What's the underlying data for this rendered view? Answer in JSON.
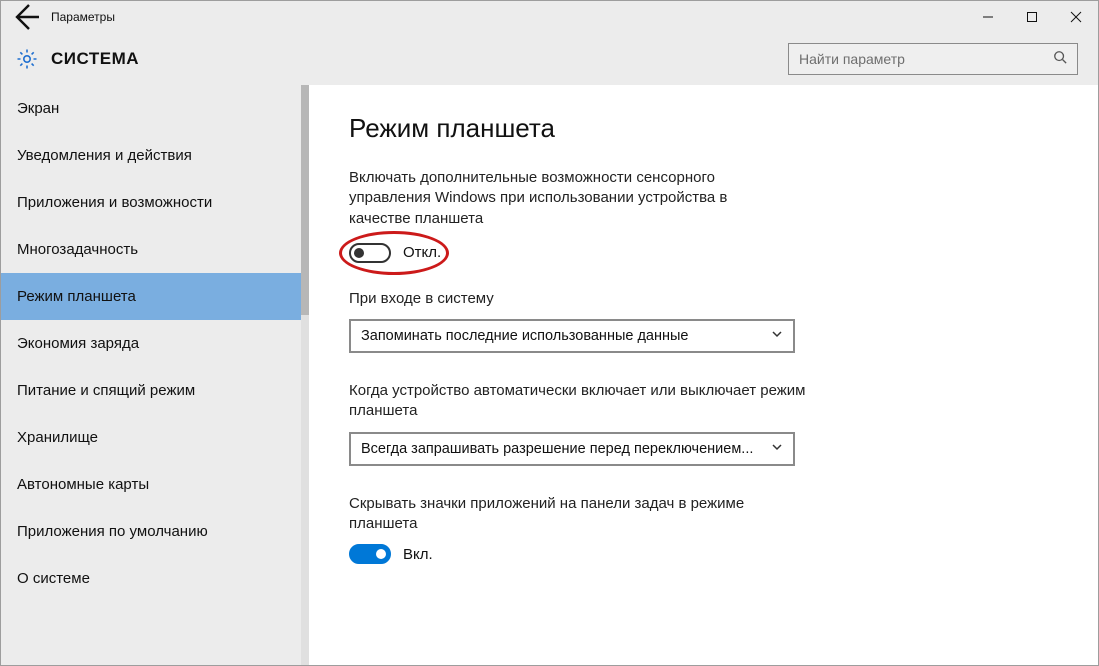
{
  "window": {
    "title": "Параметры"
  },
  "header": {
    "title": "СИСТЕМА",
    "search_placeholder": "Найти параметр"
  },
  "sidebar": {
    "items": [
      {
        "label": "Экран",
        "selected": false
      },
      {
        "label": "Уведомления и действия",
        "selected": false
      },
      {
        "label": "Приложения и возможности",
        "selected": false
      },
      {
        "label": "Многозадачность",
        "selected": false
      },
      {
        "label": "Режим планшета",
        "selected": true
      },
      {
        "label": "Экономия заряда",
        "selected": false
      },
      {
        "label": "Питание и спящий режим",
        "selected": false
      },
      {
        "label": "Хранилище",
        "selected": false
      },
      {
        "label": "Автономные карты",
        "selected": false
      },
      {
        "label": "Приложения по умолчанию",
        "selected": false
      },
      {
        "label": "О системе",
        "selected": false
      }
    ]
  },
  "content": {
    "page_title": "Режим планшета",
    "description": "Включать дополнительные возможности сенсорного управления Windows при использовании устройства в качестве планшета",
    "toggle1": {
      "state": "off",
      "label": "Откл."
    },
    "section1": {
      "label": "При входе в систему",
      "selected": "Запоминать последние использованные данные"
    },
    "section2": {
      "label": "Когда устройство автоматически включает или выключает режим планшета",
      "selected": "Всегда запрашивать разрешение перед переключением..."
    },
    "section3": {
      "label": "Скрывать значки приложений на панели задач в режиме планшета"
    },
    "toggle2": {
      "state": "on",
      "label": "Вкл."
    }
  }
}
